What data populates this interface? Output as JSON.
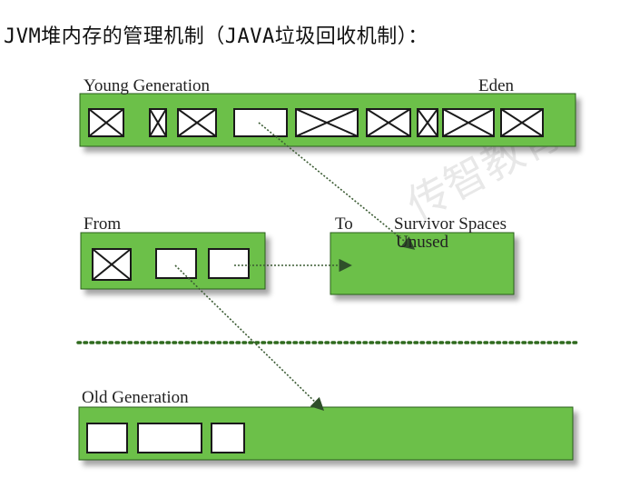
{
  "heading": "JVM堆内存的管理机制（JAVA垃圾回收机制）：",
  "labels": {
    "young_generation": "Young Generation",
    "eden": "Eden",
    "from": "From",
    "to": "To",
    "survivor_spaces": "Survivor Spaces",
    "unused": "Unused",
    "old_generation": "Old Generation"
  },
  "watermark": "传智教育",
  "colors": {
    "region_fill": "#6cc04a",
    "region_border": "#2b5e1f",
    "arrow": "#2f4f2a"
  }
}
